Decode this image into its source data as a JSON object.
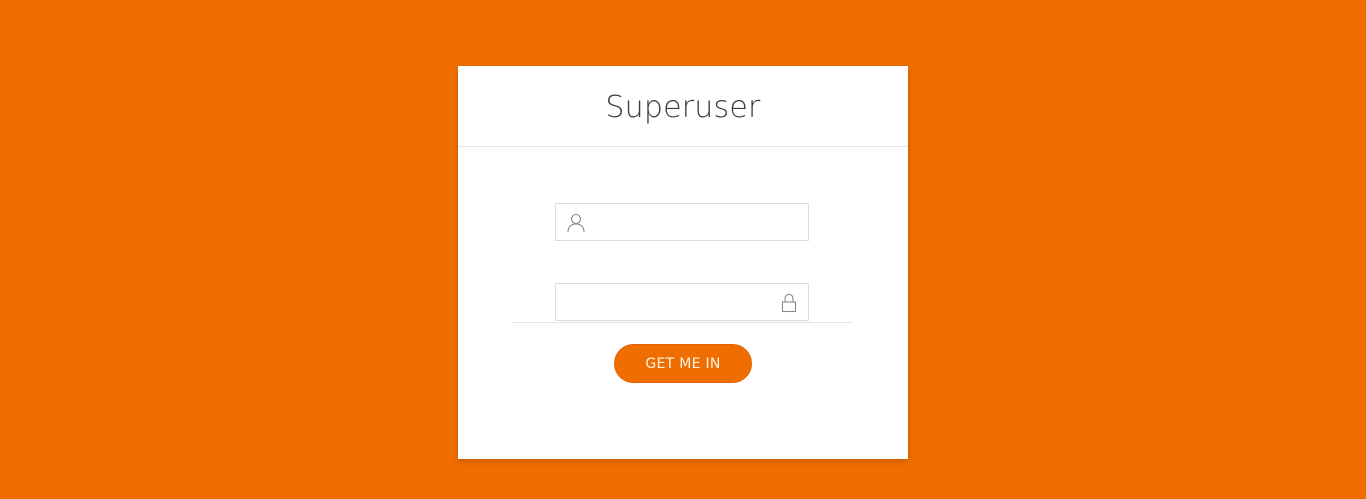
{
  "login": {
    "title": "Superuser",
    "username": {
      "value": "",
      "placeholder": "",
      "icon": "user-icon"
    },
    "password": {
      "value": "",
      "placeholder": "",
      "icon": "lock-icon"
    },
    "submit_label": "GET ME IN"
  },
  "colors": {
    "background": "#f06e00",
    "card": "#ffffff",
    "accent": "#f06e00",
    "title_text": "#3a3a3a",
    "border": "#dcdcdc"
  }
}
